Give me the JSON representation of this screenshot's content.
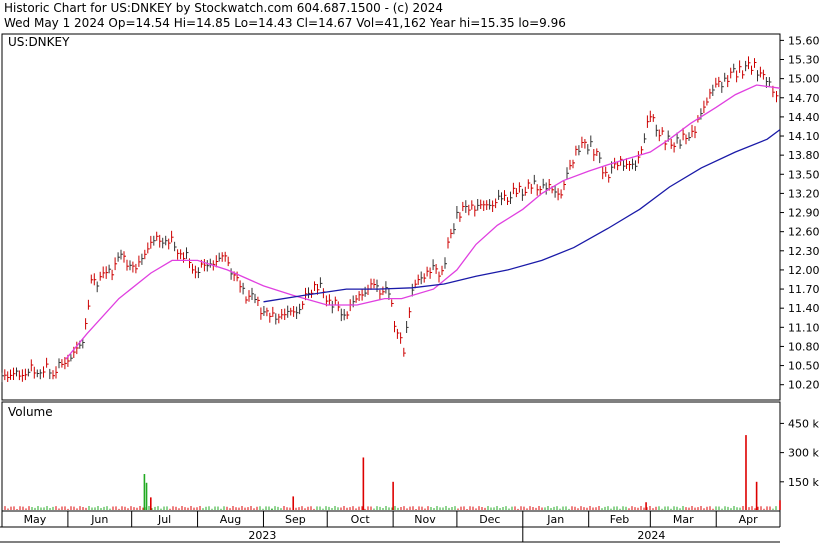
{
  "header": {
    "line1": "Historic Chart for US:DNKEY by Stockwatch.com 604.687.1500 - (c) 2024",
    "line2": "Wed May  1 2024   Op=14.54  Hi=14.85  Lo=14.43  Cl=14.67  Vol=41,162  Year hi=15.35  lo=9.96"
  },
  "colors": {
    "up": "#cc0000",
    "down": "#333333",
    "ma_short": "#e040e0",
    "ma_long": "#1a1aa8",
    "volume_up": "#dd0000",
    "volume_down": "#22aa22"
  },
  "chart_data": [
    {
      "type": "bar",
      "title": "US:DNKEY",
      "y_ticks": [
        "15.60",
        "15.30",
        "15.00",
        "14.70",
        "14.40",
        "14.10",
        "13.80",
        "13.50",
        "13.20",
        "12.90",
        "12.60",
        "12.30",
        "12.00",
        "11.70",
        "11.40",
        "11.10",
        "10.80",
        "10.50",
        "10.20"
      ],
      "ylim": [
        9.96,
        15.7
      ],
      "x_month_labels": [
        "May",
        "Jun",
        "Jul",
        "Aug",
        "Sep",
        "Oct",
        "Nov",
        "Dec",
        "Jan",
        "Feb",
        "Mar",
        "Apr"
      ],
      "x_years": [
        "2023",
        "2024"
      ],
      "x_start": "2023-05-01",
      "x_end": "2024-05-01",
      "series": [
        {
          "key": "price",
          "points": [
            [
              "2023-05-01",
              10.3
            ],
            [
              "2023-05-05",
              10.35
            ],
            [
              "2023-05-12",
              10.4
            ],
            [
              "2023-05-19",
              10.45
            ],
            [
              "2023-05-25",
              10.4
            ],
            [
              "2023-06-01",
              10.6
            ],
            [
              "2023-06-08",
              10.85
            ],
            [
              "2023-06-12",
              11.8
            ],
            [
              "2023-06-19",
              11.9
            ],
            [
              "2023-06-26",
              12.2
            ],
            [
              "2023-07-03",
              12.0
            ],
            [
              "2023-07-10",
              12.45
            ],
            [
              "2023-07-17",
              12.5
            ],
            [
              "2023-07-24",
              12.3
            ],
            [
              "2023-07-31",
              12.0
            ],
            [
              "2023-08-07",
              12.1
            ],
            [
              "2023-08-14",
              12.2
            ],
            [
              "2023-08-21",
              11.7
            ],
            [
              "2023-08-28",
              11.5
            ],
            [
              "2023-09-04",
              11.25
            ],
            [
              "2023-09-11",
              11.3
            ],
            [
              "2023-09-18",
              11.4
            ],
            [
              "2023-09-25",
              11.8
            ],
            [
              "2023-10-02",
              11.55
            ],
            [
              "2023-10-09",
              11.3
            ],
            [
              "2023-10-16",
              11.6
            ],
            [
              "2023-10-23",
              11.75
            ],
            [
              "2023-10-30",
              11.6
            ],
            [
              "2023-11-03",
              11.0
            ],
            [
              "2023-11-06",
              10.7
            ],
            [
              "2023-11-10",
              11.7
            ],
            [
              "2023-11-17",
              12.0
            ],
            [
              "2023-11-24",
              12.0
            ],
            [
              "2023-12-01",
              12.9
            ],
            [
              "2023-12-08",
              13.0
            ],
            [
              "2023-12-15",
              13.0
            ],
            [
              "2023-12-22",
              13.1
            ],
            [
              "2023-12-29",
              13.2
            ],
            [
              "2024-01-05",
              13.3
            ],
            [
              "2024-01-12",
              13.3
            ],
            [
              "2024-01-19",
              13.2
            ],
            [
              "2024-01-26",
              13.9
            ],
            [
              "2024-02-02",
              14.0
            ],
            [
              "2024-02-09",
              13.5
            ],
            [
              "2024-02-16",
              13.7
            ],
            [
              "2024-02-23",
              13.6
            ],
            [
              "2024-03-01",
              14.4
            ],
            [
              "2024-03-08",
              14.0
            ],
            [
              "2024-03-15",
              14.0
            ],
            [
              "2024-03-22",
              14.2
            ],
            [
              "2024-03-29",
              14.8
            ],
            [
              "2024-04-05",
              15.0
            ],
            [
              "2024-04-12",
              15.15
            ],
            [
              "2024-04-19",
              15.2
            ],
            [
              "2024-04-26",
              14.9
            ],
            [
              "2024-05-01",
              14.67
            ]
          ]
        },
        {
          "key": "ma_short",
          "points": [
            [
              "2023-05-31",
              10.6
            ],
            [
              "2023-06-10",
              11.0
            ],
            [
              "2023-06-25",
              11.55
            ],
            [
              "2023-07-10",
              11.95
            ],
            [
              "2023-07-20",
              12.15
            ],
            [
              "2023-08-01",
              12.15
            ],
            [
              "2023-08-15",
              12.0
            ],
            [
              "2023-09-01",
              11.75
            ],
            [
              "2023-09-15",
              11.6
            ],
            [
              "2023-10-01",
              11.45
            ],
            [
              "2023-10-15",
              11.45
            ],
            [
              "2023-10-28",
              11.55
            ],
            [
              "2023-11-05",
              11.55
            ],
            [
              "2023-11-20",
              11.7
            ],
            [
              "2023-12-01",
              12.0
            ],
            [
              "2023-12-10",
              12.4
            ],
            [
              "2023-12-20",
              12.7
            ],
            [
              "2024-01-01",
              12.95
            ],
            [
              "2024-01-10",
              13.2
            ],
            [
              "2024-01-20",
              13.4
            ],
            [
              "2024-02-01",
              13.55
            ],
            [
              "2024-02-10",
              13.65
            ],
            [
              "2024-02-20",
              13.75
            ],
            [
              "2024-03-01",
              13.85
            ],
            [
              "2024-03-10",
              14.05
            ],
            [
              "2024-03-20",
              14.3
            ],
            [
              "2024-04-01",
              14.55
            ],
            [
              "2024-04-10",
              14.75
            ],
            [
              "2024-04-20",
              14.9
            ],
            [
              "2024-05-01",
              14.85
            ]
          ]
        },
        {
          "key": "ma_long",
          "points": [
            [
              "2023-09-01",
              11.5
            ],
            [
              "2023-09-20",
              11.6
            ],
            [
              "2023-10-10",
              11.7
            ],
            [
              "2023-10-25",
              11.7
            ],
            [
              "2023-11-10",
              11.72
            ],
            [
              "2023-11-25",
              11.78
            ],
            [
              "2023-12-10",
              11.9
            ],
            [
              "2023-12-25",
              12.0
            ],
            [
              "2024-01-10",
              12.15
            ],
            [
              "2024-01-25",
              12.35
            ],
            [
              "2024-02-10",
              12.65
            ],
            [
              "2024-02-25",
              12.95
            ],
            [
              "2024-03-10",
              13.3
            ],
            [
              "2024-03-25",
              13.6
            ],
            [
              "2024-04-10",
              13.85
            ],
            [
              "2024-04-25",
              14.05
            ],
            [
              "2024-05-01",
              14.2
            ]
          ]
        }
      ]
    },
    {
      "type": "bar",
      "title": "Volume",
      "y_ticks": [
        "450 k",
        "300 k",
        "150 k"
      ],
      "ylim": [
        0,
        560000
      ],
      "series": [
        {
          "key": "volume",
          "points": [
            [
              "2023-06-10",
              5000
            ],
            [
              "2023-07-07",
              190000
            ],
            [
              "2023-07-08",
              145000
            ],
            [
              "2023-07-10",
              70000
            ],
            [
              "2023-09-05",
              12000
            ],
            [
              "2023-09-15",
              75000
            ],
            [
              "2023-10-18",
              275000
            ],
            [
              "2023-11-01",
              150000
            ],
            [
              "2024-02-28",
              45000
            ],
            [
              "2024-04-15",
              390000
            ],
            [
              "2024-04-20",
              150000
            ],
            [
              "2024-05-01",
              55000
            ]
          ]
        }
      ]
    }
  ]
}
